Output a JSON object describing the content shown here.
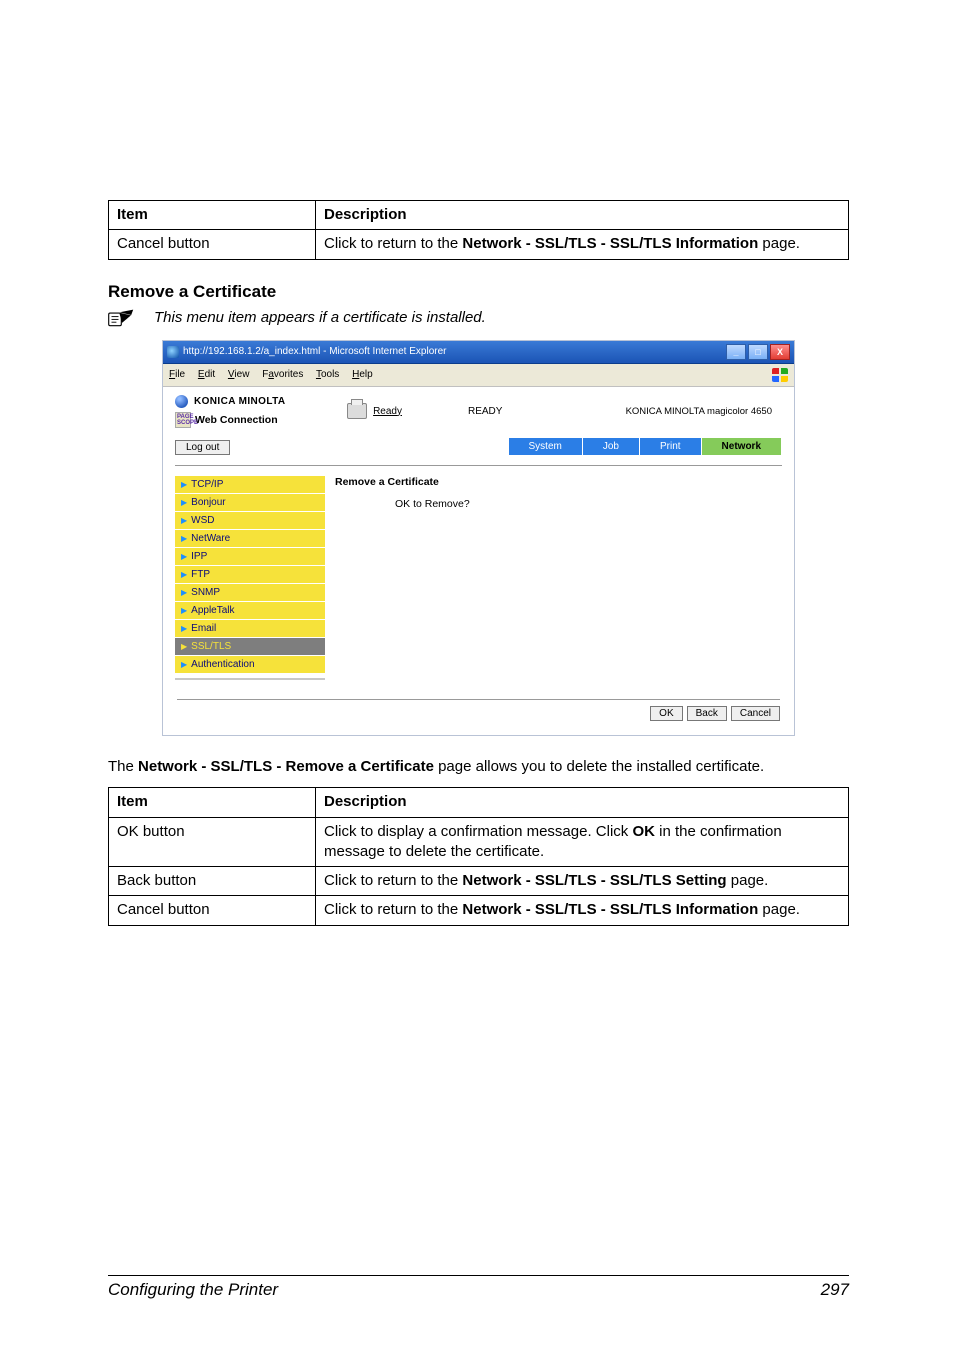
{
  "tables": {
    "top": {
      "head": {
        "c1": "Item",
        "c2": "Description"
      },
      "rows": [
        {
          "c1": "Cancel button",
          "c2_pre": "Click to return to the ",
          "c2_bold": "Network - SSL/TLS - SSL/TLS Information",
          "c2_post": " page."
        }
      ]
    },
    "bottom": {
      "head": {
        "c1": "Item",
        "c2": "Description"
      },
      "rows": [
        {
          "c1": "OK button",
          "c2_pre": "Click to display a confirmation message. Click ",
          "c2_bold": "OK",
          "c2_post": " in the confirmation message to delete the certificate."
        },
        {
          "c1": "Back button",
          "c2_pre": "Click to return to the ",
          "c2_bold": "Network - SSL/TLS - SSL/TLS Setting",
          "c2_post": " page."
        },
        {
          "c1": "Cancel button",
          "c2_pre": "Click to return to the ",
          "c2_bold": "Network - SSL/TLS - SSL/TLS Information",
          "c2_post": " page."
        }
      ]
    }
  },
  "section_heading": "Remove a Certificate",
  "note_text": "This menu item appears if a certificate is installed.",
  "body_paragraph": {
    "pre": "The ",
    "bold": "Network - SSL/TLS - Remove a Certificate",
    "post": " page allows you to delete the installed certificate."
  },
  "screenshot": {
    "titlebar": "http://192.168.1.2/a_index.html - Microsoft Internet Explorer",
    "menus": [
      "File",
      "Edit",
      "View",
      "Favorites",
      "Tools",
      "Help"
    ],
    "brand_name": "KONICA MINOLTA",
    "pagescope_label": "PAGE SCOPE",
    "connection_label": "Web Connection",
    "ready_link": "Ready",
    "ready_status": "READY",
    "model_name": "KONICA MINOLTA magicolor 4650",
    "logout_label": "Log out",
    "tabs": [
      "System",
      "Job",
      "Print",
      "Network"
    ],
    "sidemenu": [
      "TCP/IP",
      "Bonjour",
      "WSD",
      "NetWare",
      "IPP",
      "FTP",
      "SNMP",
      "AppleTalk",
      "Email",
      "SSL/TLS",
      "Authentication"
    ],
    "content_title": "Remove a Certificate",
    "content_body": "OK to Remove?",
    "buttons": {
      "ok": "OK",
      "back": "Back",
      "cancel": "Cancel"
    },
    "win_buttons": {
      "min": "_",
      "max": "□",
      "close": "X"
    }
  },
  "footer": {
    "left": "Configuring the Printer",
    "right": "297"
  }
}
